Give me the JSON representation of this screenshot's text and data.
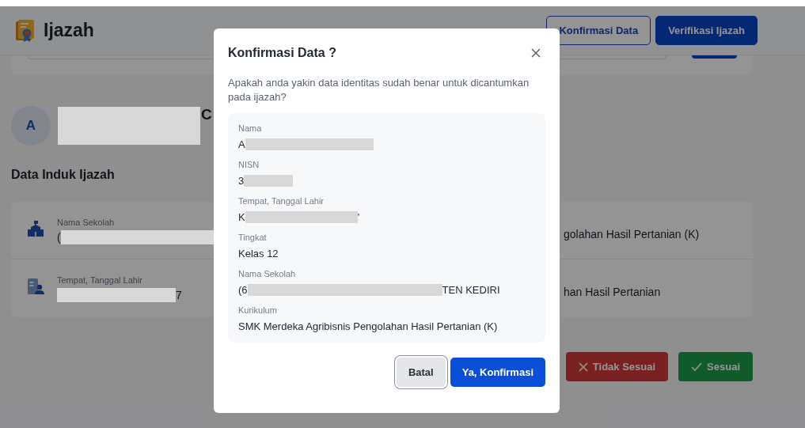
{
  "header": {
    "title": "Ijazah",
    "buttons": [
      {
        "label": "Konfirmasi Data",
        "kind": "outline"
      },
      {
        "label": "Verifikasi Ijazah",
        "kind": "primary"
      }
    ]
  },
  "profile": {
    "avatar": "A",
    "redacted": true,
    "name_end": "C"
  },
  "section_title": "Data Induk Ijazah",
  "info_rows": [
    {
      "label": "Nama Sekolah",
      "value_start": "(",
      "redacted": true,
      "right_value": "golahan Hasil Pertanian (K)"
    },
    {
      "label": "Tempat, Tanggal Lahir",
      "value_end": "7",
      "redacted": true,
      "right_value": "han Hasil Pertanian"
    }
  ],
  "actions": [
    {
      "label": "Tidak Sesuai",
      "kind": "reject"
    },
    {
      "label": "Sesuai",
      "kind": "accept"
    }
  ],
  "dialog": {
    "title": "Konfirmasi Data ?",
    "message": "Apakah anda yakin data identitas sudah benar untuk dicantumkan pada ijazah?",
    "fields": [
      {
        "label": "Nama",
        "value_start": "A",
        "redacted": true
      },
      {
        "label": "NISN",
        "value_start": "3",
        "redacted": true
      },
      {
        "label": "Tempat, Tanggal Lahir",
        "value_start": "K",
        "value_end": "'",
        "redacted": true
      },
      {
        "label": "Tingkat",
        "value_start": "Kelas 12",
        "redacted": false
      },
      {
        "label": "Nama Sekolah",
        "value_start": "(6",
        "value_end": "TEN KEDIRI",
        "redacted": true
      },
      {
        "label": "Kurikulum",
        "value_start": "SMK Merdeka Agribisnis Pengolahan Hasil Pertanian (K)",
        "redacted": false
      }
    ],
    "buttons": [
      {
        "label": "Batal",
        "kind": "secondary",
        "focused": true
      },
      {
        "label": "Ya, Konfirmasi",
        "kind": "primary",
        "focused": false
      }
    ]
  }
}
